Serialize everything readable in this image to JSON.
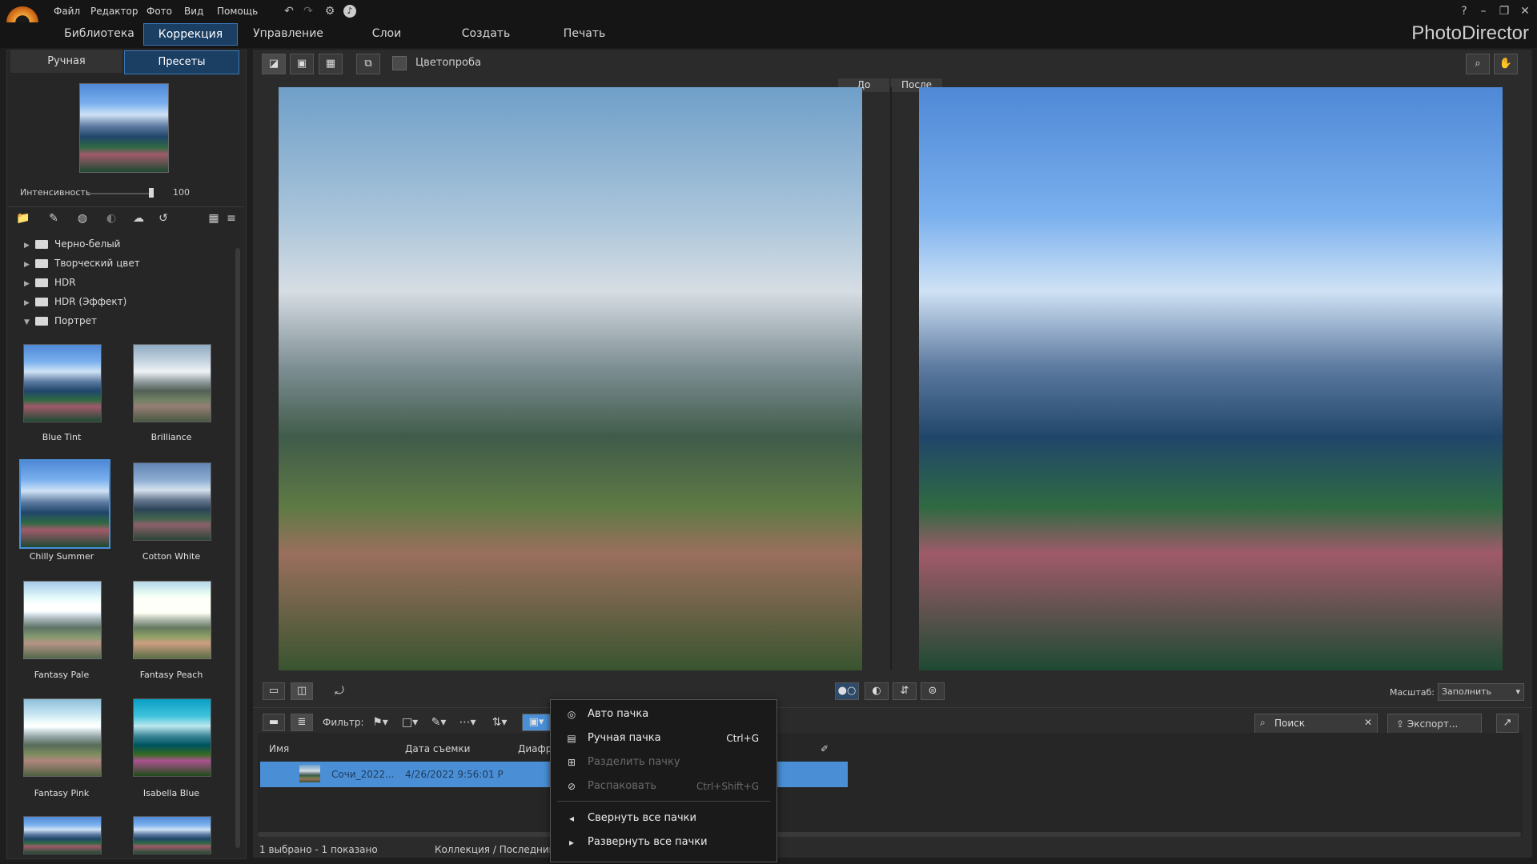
{
  "menubar": {
    "items": [
      "Файл",
      "Редактор",
      "Фото",
      "Вид",
      "Помощь"
    ]
  },
  "modules": {
    "tabs": [
      "Библиотека",
      "Коррекция",
      "Управление",
      "Слои",
      "Создать",
      "Печать"
    ],
    "active": "Коррекция",
    "brand": "PhotoDirector"
  },
  "left_panel": {
    "tabs": [
      "Ручная",
      "Пресеты"
    ],
    "active_tab": "Пресеты",
    "intensity_label": "Интенсивность",
    "intensity_value": "100",
    "tree": [
      {
        "label": "Черно-белый",
        "expanded": false
      },
      {
        "label": "Творческий цвет",
        "expanded": false
      },
      {
        "label": "HDR",
        "expanded": false
      },
      {
        "label": "HDR (Эффект)",
        "expanded": false
      },
      {
        "label": "Портрет",
        "expanded": true
      }
    ],
    "presets": [
      "Blue Tint",
      "Brilliance",
      "Chilly Summer",
      "Cotton White",
      "Fantasy Pale",
      "Fantasy Peach",
      "Fantasy Pink",
      "Isabella Blue"
    ],
    "selected_preset": "Chilly Summer"
  },
  "view_toolbar": {
    "colorprobe_label": "Цветопроба"
  },
  "compare": {
    "before_label": "До",
    "after_label": "После"
  },
  "bottom_toolbar": {
    "scale_label": "Масштаб:",
    "scale_value": "Заполнить",
    "filter_label": "Фильтр:",
    "search_placeholder": "Поиск",
    "export_label": "Экспорт..."
  },
  "grid": {
    "columns": [
      "Имя",
      "Дата съемки",
      "Диафр"
    ],
    "row": {
      "name": "Сочи_2022...",
      "date": "4/26/2022 9:56:01 P"
    }
  },
  "status": {
    "selection": "1 выбрано - 1 показано",
    "collection": "Коллекция / Последний"
  },
  "context_menu": {
    "items": [
      {
        "label": "Авто пачка",
        "shortcut": "",
        "disabled": false
      },
      {
        "label": "Ручная пачка",
        "shortcut": "Ctrl+G",
        "disabled": false
      },
      {
        "label": "Разделить пачку",
        "shortcut": "",
        "disabled": true
      },
      {
        "label": "Распаковать",
        "shortcut": "Ctrl+Shift+G",
        "disabled": true
      },
      {
        "label": "Свернуть все пачки",
        "shortcut": "",
        "disabled": false
      },
      {
        "label": "Развернуть все пачки",
        "shortcut": "",
        "disabled": false
      }
    ]
  }
}
